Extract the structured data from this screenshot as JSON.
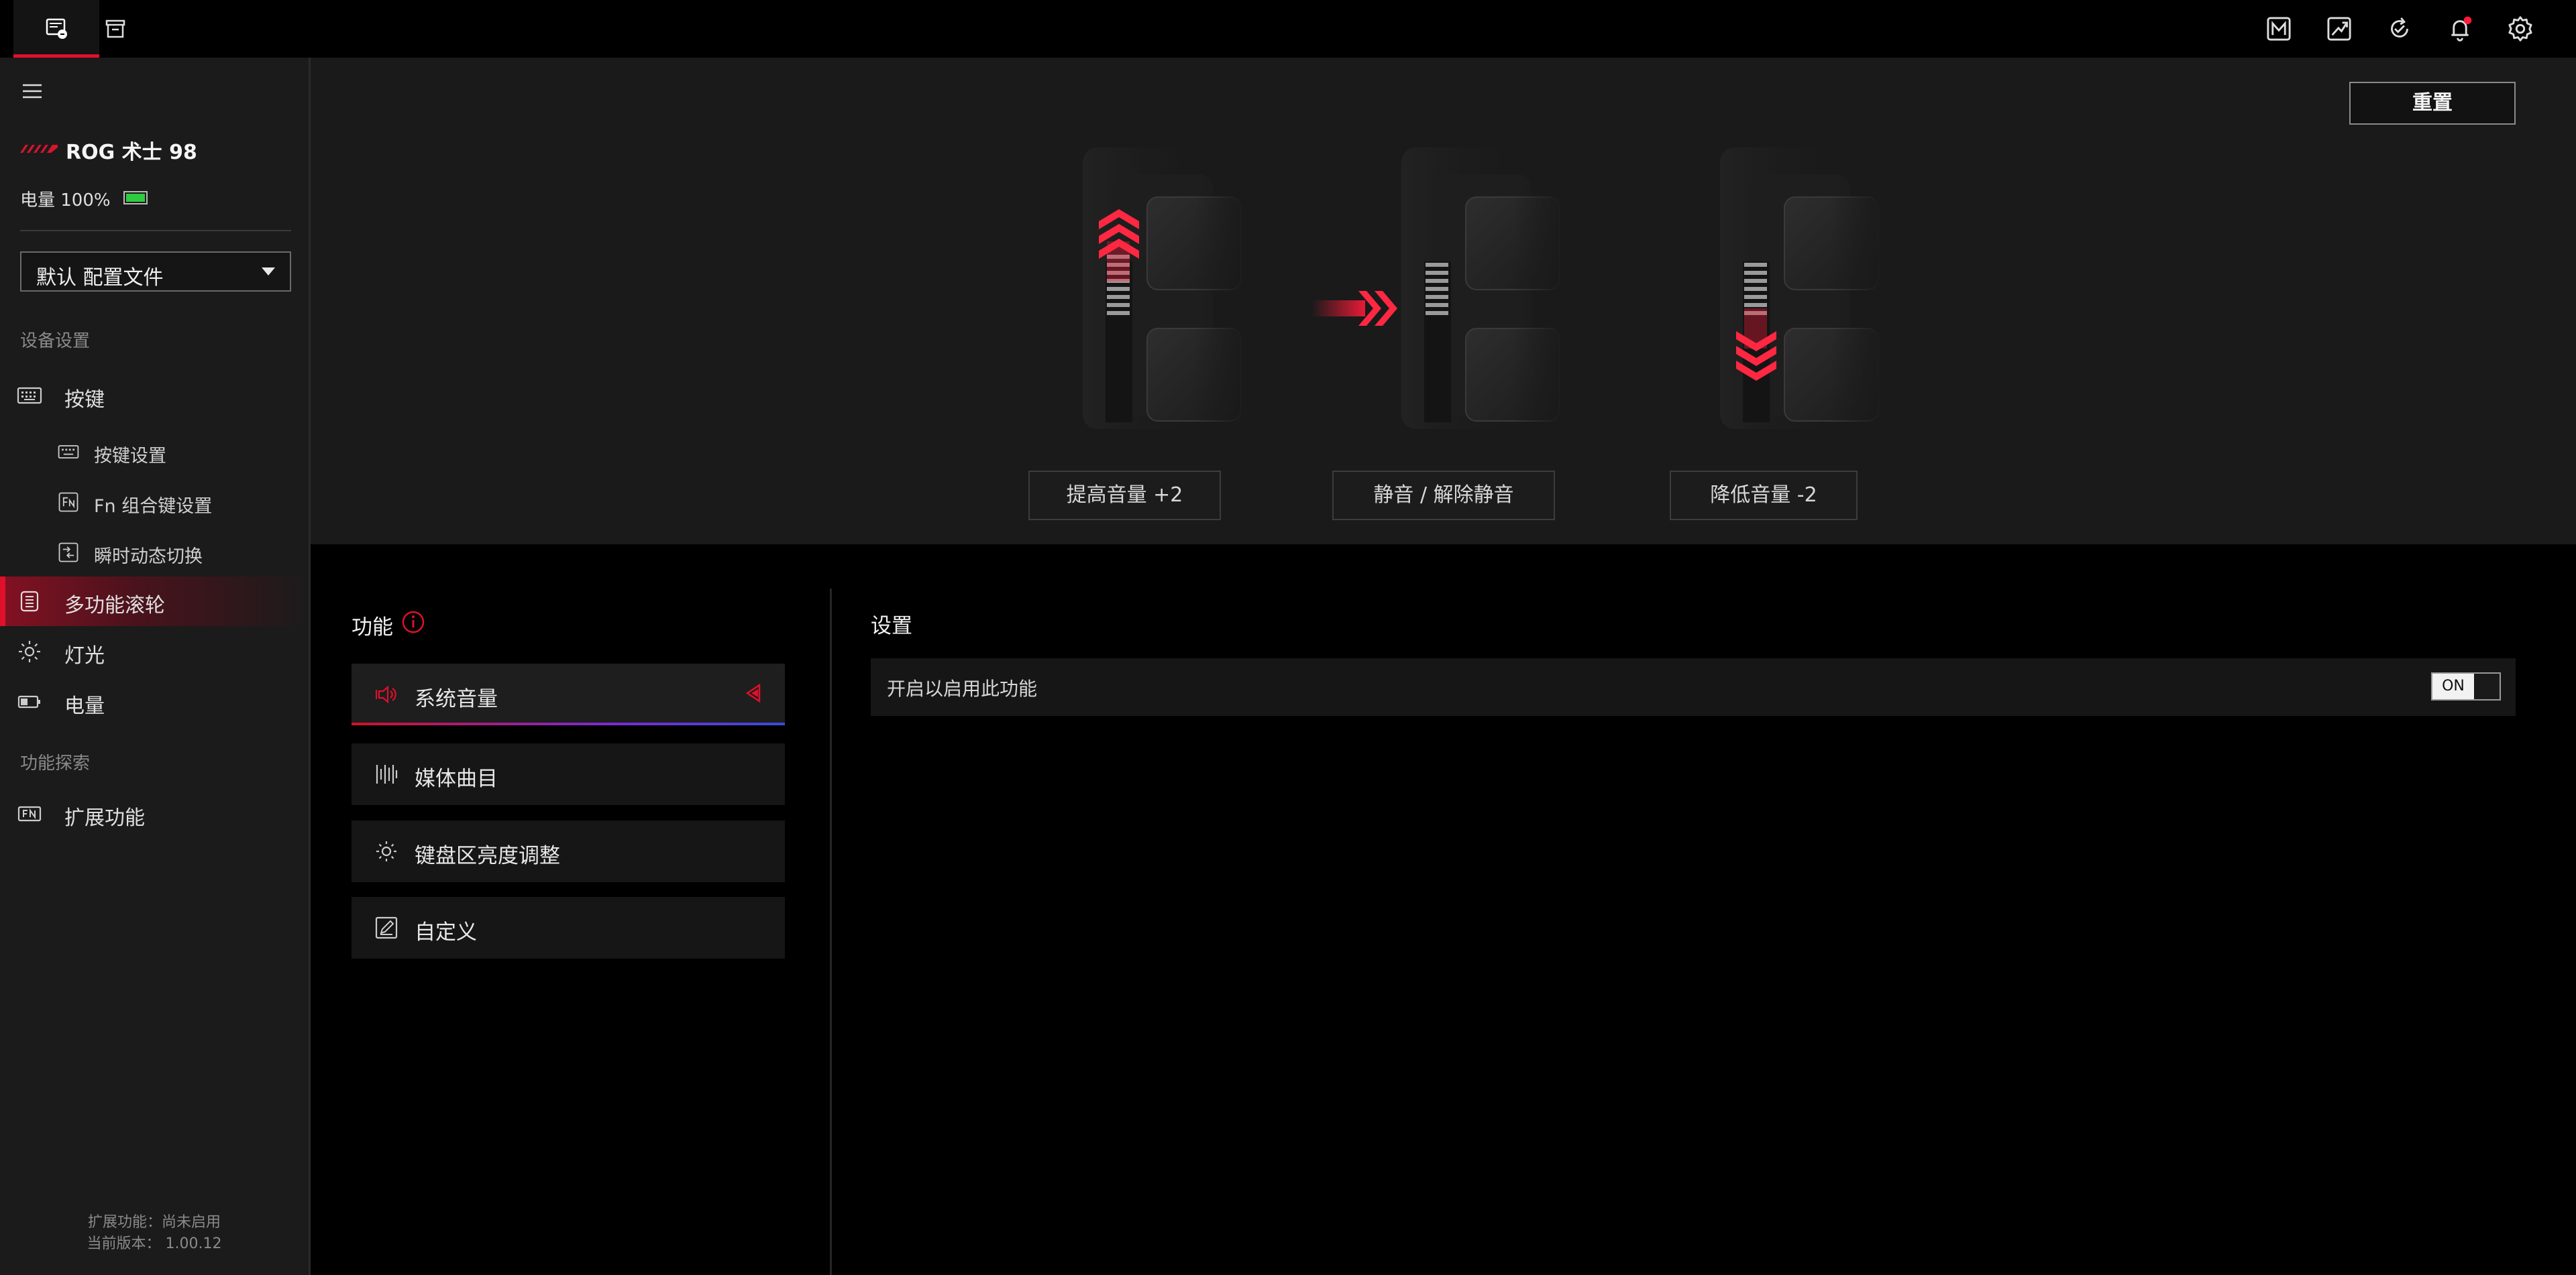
{
  "sidebar": {
    "device_name": "ROG 术士 98",
    "battery": "电量 100%",
    "battery_level_percent": 100,
    "profile": "默认 配置文件",
    "section_device_settings": "设备设置",
    "nav_keys": "按键",
    "sub_key_settings": "按键设置",
    "sub_fn_combo": "Fn 组合键设置",
    "sub_instant_switch": "瞬时动态切换",
    "nav_multifunction_wheel": "多功能滚轮",
    "nav_lighting": "灯光",
    "nav_power": "电量",
    "section_explore": "功能探索",
    "nav_extensions": "扩展功能",
    "footer_extension_status": "扩展功能：尚未启用",
    "footer_version": "当前版本： 1.00.12"
  },
  "preview": {
    "reset": "重置",
    "actions": [
      "提高音量 +2",
      "静音 / 解除静音",
      "降低音量 -2"
    ]
  },
  "functions": {
    "title": "功能",
    "items": [
      "系统音量",
      "媒体曲目",
      "键盘区亮度调整",
      "自定义"
    ]
  },
  "settings": {
    "title": "设置",
    "enable_label": "开启以启用此功能",
    "toggle_state": "ON"
  },
  "colors": {
    "accent": "#e0102a",
    "battery": "#2ecc40"
  }
}
